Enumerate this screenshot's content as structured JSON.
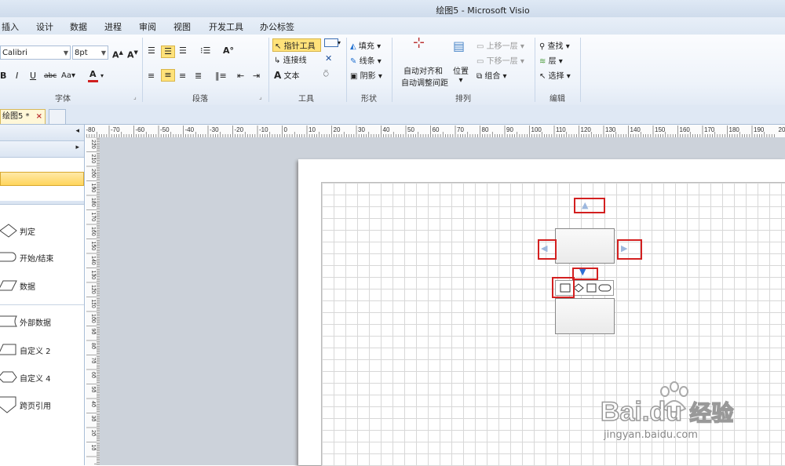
{
  "window": {
    "title": "绘图5 - Microsoft Visio"
  },
  "menu": [
    "插入",
    "设计",
    "数据",
    "进程",
    "审阅",
    "视图",
    "开发工具",
    "办公标签"
  ],
  "ribbon": {
    "font": {
      "name": "Calibri",
      "size": "8pt",
      "group_label": "字体"
    },
    "paragraph": {
      "group_label": "段落"
    },
    "tools": {
      "pointer": "指针工具",
      "connector": "连接线",
      "text": "文本",
      "group_label": "工具"
    },
    "shape_style": {
      "fill": "填充",
      "line": "线条",
      "shadow": "阴影",
      "group_label": "形状"
    },
    "arrange": {
      "auto_align": "自动对齐和",
      "auto_space": "自动调整间距",
      "position": "位置",
      "bring_forward": "上移一层",
      "send_backward": "下移一层",
      "group": "组合",
      "group_label": "排列"
    },
    "editing": {
      "find": "查找",
      "layers": "层",
      "select": "选择",
      "group_label": "编辑"
    }
  },
  "doc_tab": {
    "label": "绘图5 *",
    "close": "×"
  },
  "shapes_pane": {
    "items": [
      "判定",
      "开始/结束",
      "数据",
      "外部数据",
      "自定义 2",
      "自定义 4",
      "跨页引用"
    ]
  },
  "ruler_top": [
    "-80",
    "-70",
    "-60",
    "-50",
    "-40",
    "-30",
    "-20",
    "-10",
    "0",
    "10",
    "20",
    "30",
    "40",
    "50",
    "60",
    "70",
    "80",
    "90",
    "100",
    "110",
    "120",
    "130",
    "140",
    "150",
    "160",
    "170",
    "180",
    "190",
    "200"
  ],
  "ruler_left": [
    "220",
    "210",
    "200",
    "190",
    "180",
    "170",
    "160",
    "150",
    "140",
    "130",
    "120",
    "110",
    "100",
    "90",
    "80",
    "70",
    "60",
    "50",
    "40",
    "30",
    "20",
    "10"
  ],
  "watermark": {
    "brand": "Bai",
    "brand2": "du",
    "cn": "经验",
    "url": "jingyan.baidu.com"
  },
  "colors": {
    "accent": "#ffe27a",
    "highlight_red": "#d32020",
    "arrow_blue": "#2a6fd6"
  }
}
